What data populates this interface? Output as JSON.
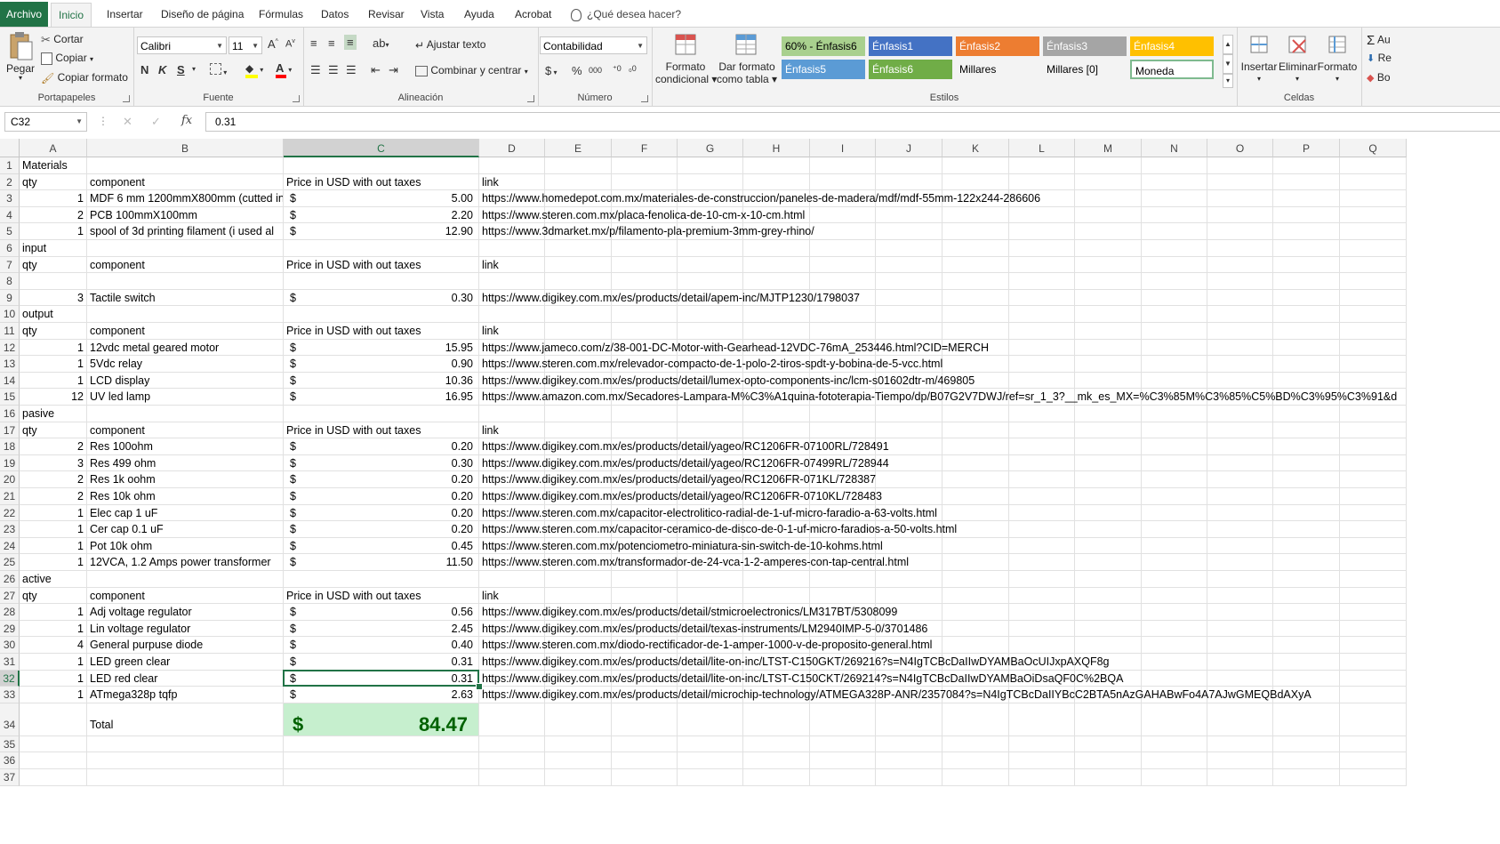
{
  "tabs": [
    "Archivo",
    "Inicio",
    "Insertar",
    "Diseño de página",
    "Fórmulas",
    "Datos",
    "Revisar",
    "Vista",
    "Ayuda",
    "Acrobat"
  ],
  "tell_me": "¿Qué desea hacer?",
  "ribbon": {
    "portapapeles": {
      "label": "Portapapeles",
      "paste": "Pegar",
      "cut": "Cortar",
      "copy": "Copiar",
      "format_painter": "Copiar formato"
    },
    "fuente": {
      "label": "Fuente",
      "font": "Calibri",
      "size": "11",
      "bold": "N",
      "italic": "K",
      "underline": "S"
    },
    "alineacion": {
      "label": "Alineación",
      "wrap": "Ajustar texto",
      "merge": "Combinar y centrar"
    },
    "numero": {
      "label": "Número",
      "format": "Contabilidad",
      "currency": "$",
      "percent": "%",
      "thousands": "000"
    },
    "estilos": {
      "label": "Estilos",
      "cond_format": [
        "Formato",
        "condicional"
      ],
      "table_format": [
        "Dar formato",
        "como tabla"
      ],
      "cells": [
        {
          "text": "60% - Énfasis6",
          "bg": "#a9d08e",
          "color": "#000000"
        },
        {
          "text": "Énfasis1",
          "bg": "#4472c4",
          "color": "#ffffff"
        },
        {
          "text": "Énfasis2",
          "bg": "#ed7d31",
          "color": "#ffffff"
        },
        {
          "text": "Énfasis3",
          "bg": "#a5a5a5",
          "color": "#ffffff"
        },
        {
          "text": "Énfasis4",
          "bg": "#ffc000",
          "color": "#ffffff"
        },
        {
          "text": "Énfasis5",
          "bg": "#5b9bd5",
          "color": "#ffffff"
        },
        {
          "text": "Énfasis6",
          "bg": "#70ad47",
          "color": "#ffffff"
        },
        {
          "text": "Millares",
          "bg": "#f3f3f3",
          "color": "#000000"
        },
        {
          "text": "Millares [0]",
          "bg": "#f3f3f3",
          "color": "#000000"
        },
        {
          "text": "Moneda",
          "bg": "#ffffff",
          "color": "#000000"
        }
      ]
    },
    "celdas": {
      "label": "Celdas",
      "insert": "Insertar",
      "delete": "Eliminar",
      "format": "Formato"
    },
    "edit": {
      "autosum": "Au",
      "fill": "Re",
      "clear": "Bo"
    }
  },
  "formula_bar": {
    "name_box": "C32",
    "formula": "0.31"
  },
  "columns": [
    "A",
    "B",
    "C",
    "D",
    "E",
    "F",
    "G",
    "H",
    "I",
    "J",
    "K",
    "L",
    "M",
    "N",
    "O",
    "P",
    "Q"
  ],
  "rows": [
    {
      "n": 1,
      "a": "Materials",
      "b": "",
      "c": "",
      "price": "",
      "d": ""
    },
    {
      "n": 2,
      "a": "qty",
      "b": "component",
      "c": "  Price in USD with out taxes",
      "price": "",
      "d": "link"
    },
    {
      "n": 3,
      "a": "1",
      "b": "MDF 6 mm 1200mmX800mm (cutted in",
      "c": "",
      "price": "5.00",
      "d": "https://www.homedepot.com.mx/materiales-de-construccion/paneles-de-madera/mdf/mdf-55mm-122x244-286606"
    },
    {
      "n": 4,
      "a": "2",
      "b": "PCB 100mmX100mm",
      "c": "",
      "price": "2.20",
      "d": "https://www.steren.com.mx/placa-fenolica-de-10-cm-x-10-cm.html"
    },
    {
      "n": 5,
      "a": "1",
      "b": "spool of 3d printing filament (i used al",
      "c": "",
      "price": "12.90",
      "d": "https://www.3dmarket.mx/p/filamento-pla-premium-3mm-grey-rhino/"
    },
    {
      "n": 6,
      "a": "input",
      "b": "",
      "c": "",
      "price": "",
      "d": ""
    },
    {
      "n": 7,
      "a": "qty",
      "b": "component",
      "c": "Price in USD with out taxes",
      "price": "",
      "d": "link"
    },
    {
      "n": 8,
      "a": "",
      "b": "",
      "c": "",
      "price": "",
      "d": ""
    },
    {
      "n": 9,
      "a": "3",
      "b": "Tactile switch",
      "c": "",
      "price": "0.30",
      "d": "https://www.digikey.com.mx/es/products/detail/apem-inc/MJTP1230/1798037"
    },
    {
      "n": 10,
      "a": "output",
      "b": "",
      "c": "",
      "price": "",
      "d": ""
    },
    {
      "n": 11,
      "a": "qty",
      "b": "component",
      "c": "Price in USD with out taxes",
      "price": "",
      "d": "link"
    },
    {
      "n": 12,
      "a": "1",
      "b": "12vdc metal geared motor",
      "c": "",
      "price": "15.95",
      "d": "https://www.jameco.com/z/38-001-DC-Motor-with-Gearhead-12VDC-76mA_253446.html?CID=MERCH"
    },
    {
      "n": 13,
      "a": "1",
      "b": "5Vdc relay",
      "c": "",
      "price": "0.90",
      "d": "https://www.steren.com.mx/relevador-compacto-de-1-polo-2-tiros-spdt-y-bobina-de-5-vcc.html"
    },
    {
      "n": 14,
      "a": "1",
      "b": "LCD display",
      "c": "",
      "price": "10.36",
      "d": "https://www.digikey.com.mx/es/products/detail/lumex-opto-components-inc/lcm-s01602dtr-m/469805"
    },
    {
      "n": 15,
      "a": "12",
      "b": "UV led lamp",
      "c": "",
      "price": "16.95",
      "d": "https://www.amazon.com.mx/Secadores-Lampara-M%C3%A1quina-fototerapia-Tiempo/dp/B07G2V7DWJ/ref=sr_1_3?__mk_es_MX=%C3%85M%C3%85%C5%BD%C3%95%C3%91&d"
    },
    {
      "n": 16,
      "a": "pasive",
      "b": "",
      "c": "",
      "price": "",
      "d": ""
    },
    {
      "n": 17,
      "a": "qty",
      "b": "component",
      "c": "Price in USD with out taxes",
      "price": "",
      "d": "link"
    },
    {
      "n": 18,
      "a": "2",
      "b": "Res 100ohm",
      "c": "",
      "price": "0.20",
      "d": "https://www.digikey.com.mx/es/products/detail/yageo/RC1206FR-07100RL/728491"
    },
    {
      "n": 19,
      "a": "3",
      "b": "Res 499 ohm",
      "c": "",
      "price": "0.30",
      "d": "https://www.digikey.com.mx/es/products/detail/yageo/RC1206FR-07499RL/728944"
    },
    {
      "n": 20,
      "a": "2",
      "b": "Res 1k oohm",
      "c": "",
      "price": "0.20",
      "d": "https://www.digikey.com.mx/es/products/detail/yageo/RC1206FR-071KL/728387"
    },
    {
      "n": 21,
      "a": "2",
      "b": "Res 10k ohm",
      "c": "",
      "price": "0.20",
      "d": "https://www.digikey.com.mx/es/products/detail/yageo/RC1206FR-0710KL/728483"
    },
    {
      "n": 22,
      "a": "1",
      "b": "Elec cap 1 uF",
      "c": "",
      "price": "0.20",
      "d": "https://www.steren.com.mx/capacitor-electrolitico-radial-de-1-uf-micro-faradio-a-63-volts.html"
    },
    {
      "n": 23,
      "a": "1",
      "b": "Cer cap 0.1 uF",
      "c": "",
      "price": "0.20",
      "d": "https://www.steren.com.mx/capacitor-ceramico-de-disco-de-0-1-uf-micro-faradios-a-50-volts.html"
    },
    {
      "n": 24,
      "a": "1",
      "b": "Pot 10k ohm",
      "c": "",
      "price": "0.45",
      "d": "https://www.steren.com.mx/potenciometro-miniatura-sin-switch-de-10-kohms.html"
    },
    {
      "n": 25,
      "a": "1",
      "b": "12VCA, 1.2 Amps  power transformer",
      "c": "",
      "price": "11.50",
      "d": "https://www.steren.com.mx/transformador-de-24-vca-1-2-amperes-con-tap-central.html"
    },
    {
      "n": 26,
      "a": "active",
      "b": "",
      "c": "",
      "price": "",
      "d": ""
    },
    {
      "n": 27,
      "a": "qty",
      "b": "component",
      "c": "Price in USD with out taxes",
      "price": "",
      "d": "link"
    },
    {
      "n": 28,
      "a": "1",
      "b": "Adj voltage regulator",
      "c": "",
      "price": "0.56",
      "d": "https://www.digikey.com.mx/es/products/detail/stmicroelectronics/LM317BT/5308099"
    },
    {
      "n": 29,
      "a": "1",
      "b": "Lin voltage regulator",
      "c": "",
      "price": "2.45",
      "d": "https://www.digikey.com.mx/es/products/detail/texas-instruments/LM2940IMP-5-0/3701486"
    },
    {
      "n": 30,
      "a": "4",
      "b": "General purpuse diode",
      "c": "",
      "price": "0.40",
      "d": "https://www.steren.com.mx/diodo-rectificador-de-1-amper-1000-v-de-proposito-general.html"
    },
    {
      "n": 31,
      "a": "1",
      "b": "LED green clear",
      "c": "",
      "price": "0.31",
      "d": "https://www.digikey.com.mx/es/products/detail/lite-on-inc/LTST-C150GKT/269216?s=N4IgTCBcDaIIwDYAMBaOcUIJxpAXQF8g"
    },
    {
      "n": 32,
      "a": "1",
      "b": "LED red clear",
      "c": "",
      "price": "0.31",
      "d": "https://www.digikey.com.mx/es/products/detail/lite-on-inc/LTST-C150CKT/269214?s=N4IgTCBcDaIIwDYAMBaOiDsaQF0C%2BQA"
    },
    {
      "n": 33,
      "a": "1",
      "b": "ATmega328p tqfp",
      "c": "",
      "price": "2.63",
      "d": "https://www.digikey.com.mx/es/products/detail/microchip-technology/ATMEGA328P-ANR/2357084?s=N4IgTCBcDaIIYBcC2BTA5nAzGAHABwFo4A7AJwGMEQBdAXyA"
    },
    {
      "n": 34,
      "a": "",
      "b": "Total",
      "c": "",
      "price": "84.47",
      "d": ""
    },
    {
      "n": 35,
      "a": "",
      "b": "",
      "c": "",
      "price": "",
      "d": ""
    },
    {
      "n": 36,
      "a": "",
      "b": "",
      "c": "",
      "price": "",
      "d": ""
    },
    {
      "n": 37,
      "a": "",
      "b": "",
      "c": "",
      "price": "",
      "d": ""
    }
  ],
  "currency_symbol": "$",
  "colors": {
    "excel_green": "#217346",
    "total_bg": "#c6efce",
    "total_fg": "#006100"
  }
}
